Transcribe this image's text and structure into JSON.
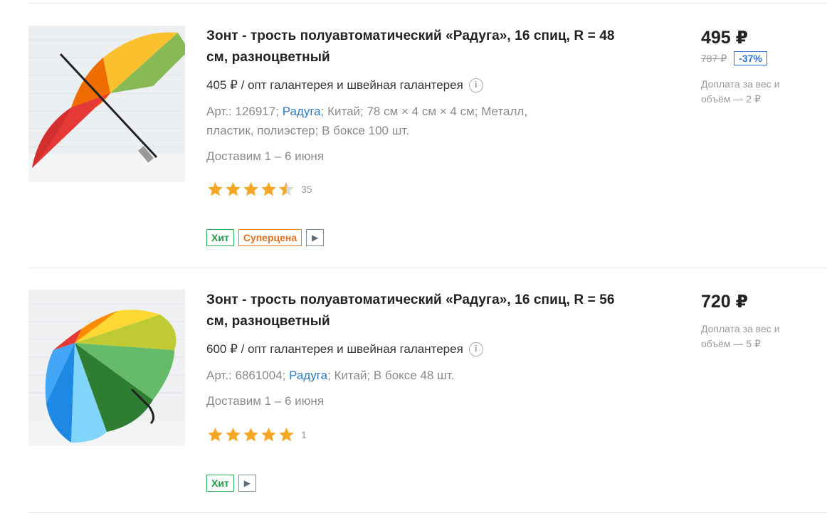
{
  "products": [
    {
      "title": "Зонт - трость полуавтоматический «Радуга», 16 спиц, R = 48 см, разноцветный",
      "wholesale": "405 ₽ / опт галантерея и швейная галантерея",
      "meta_prefix": "Арт.: 126917;",
      "brand": "Радуга",
      "meta_suffix": "; Китай; 78 см × 4 см × 4 см; Металл, пластик, полиэстер; В боксе 100 шт.",
      "delivery": "Доставим 1 – 6 июня",
      "rating": 4.5,
      "reviews": "35",
      "badges": [
        "Хит",
        "Суперцена"
      ],
      "price": "495 ₽",
      "old_price": "787 ₽",
      "discount": "-37%",
      "extra": "Доплата за вес и объём — 2 ₽"
    },
    {
      "title": "Зонт - трость полуавтоматический «Радуга», 16 спиц, R = 56 см, разноцветный",
      "wholesale": "600 ₽ / опт галантерея и швейная галантерея",
      "meta_prefix": "Арт.: 6861004;",
      "brand": "Радуга",
      "meta_suffix": "; Китай; В боксе 48 шт.",
      "delivery": "Доставим 1 – 6 июня",
      "rating": 5,
      "reviews": "1",
      "badges": [
        "Хит"
      ],
      "price": "720 ₽",
      "extra": "Доплата за вес и объём — 5 ₽"
    }
  ],
  "icons": {
    "info": "info-icon",
    "video": "play-icon",
    "star": "star-icon"
  },
  "colors": {
    "star": "#f5a623",
    "brand_link": "#2f7bbd",
    "hit": "#2bb35b",
    "super": "#e67c22",
    "discount": "#2f6fd6"
  }
}
